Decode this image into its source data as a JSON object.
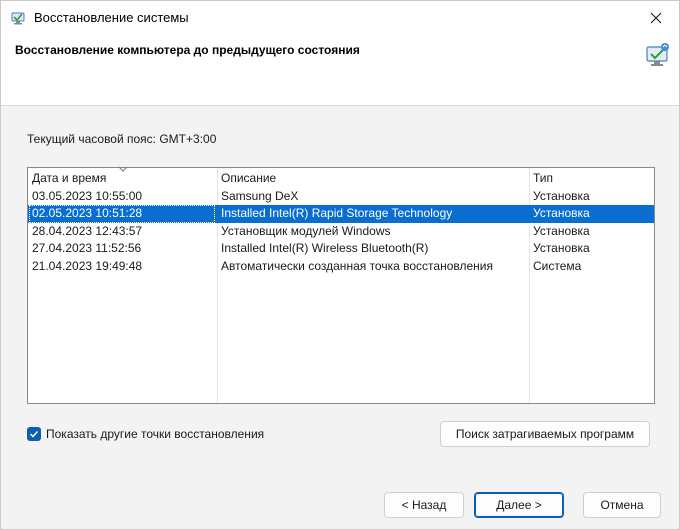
{
  "window": {
    "title": "Восстановление системы",
    "close_icon": "close-icon"
  },
  "header": {
    "title": "Восстановление компьютера до предыдущего состояния"
  },
  "timezone_label": "Текущий часовой пояс: GMT+3:00",
  "list": {
    "columns": [
      "Дата и время",
      "Описание",
      "Тип"
    ],
    "rows": [
      {
        "date": "03.05.2023 10:55:00",
        "description": "Samsung DeX",
        "type": "Установка"
      },
      {
        "date": "02.05.2023 10:51:28",
        "description": "Installed Intel(R) Rapid Storage Technology",
        "type": "Установка"
      },
      {
        "date": "28.04.2023 12:43:57",
        "description": "Установщик модулей Windows",
        "type": "Установка"
      },
      {
        "date": "27.04.2023 11:52:56",
        "description": "Installed Intel(R) Wireless Bluetooth(R)",
        "type": "Установка"
      },
      {
        "date": "21.04.2023 19:49:48",
        "description": "Автоматически созданная точка восстановления",
        "type": "Система"
      }
    ],
    "selected_index": 1
  },
  "show_more": {
    "label": "Показать другие точки восстановления",
    "checked": true
  },
  "buttons": {
    "affected": "Поиск затрагиваемых программ",
    "back": "< Назад",
    "next": "Далее >",
    "cancel": "Отмена"
  },
  "colors": {
    "selection": "#0a6ed1",
    "accent": "#0a5fb4"
  }
}
